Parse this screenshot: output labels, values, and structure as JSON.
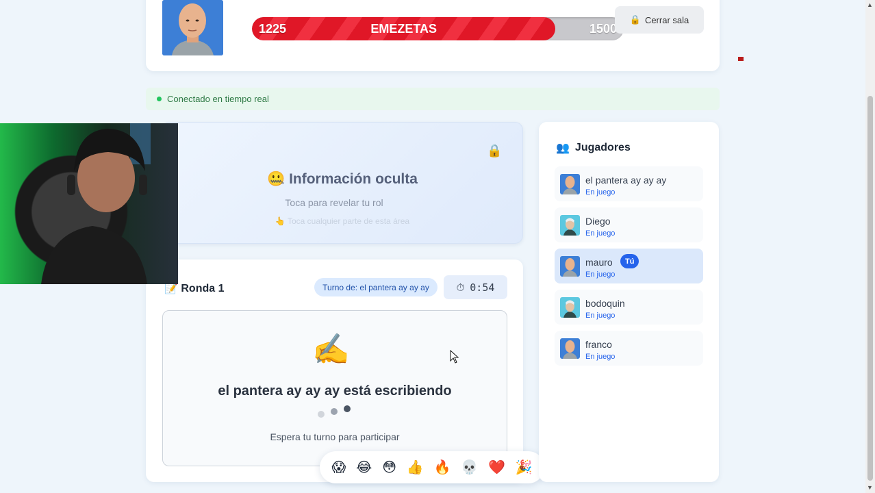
{
  "header": {
    "score_current": "1225",
    "score_title": "EMEZETAS",
    "score_max": "1500",
    "score_progress": 0.8167,
    "close_room_label": "Cerrar sala",
    "close_room_icon": "lock-icon"
  },
  "connection": {
    "status_text": "Conectado en tiempo real",
    "status_color": "#22c55e"
  },
  "hidden_info": {
    "title_emoji": "🤐",
    "title": "Información oculta",
    "subtitle": "Toca para revelar tu rol",
    "hint_emoji": "👆",
    "hint": "Toca cualquier parte de esta área",
    "lock_emoji": "🔒"
  },
  "round": {
    "icon": "📝",
    "title": "Ronda 1",
    "turn_label": "Turno de: el pantera ay ay ay",
    "timer_icon": "⏱",
    "timer": "0:54",
    "writing_emoji": "✍️",
    "writing_text": "el pantera ay ay ay está escribiendo",
    "wait_text": "Espera tu turno para participar"
  },
  "reactions": [
    "😱",
    "😂",
    "😳",
    "👍",
    "🔥",
    "💀",
    "❤️",
    "🎉"
  ],
  "players": {
    "icon": "👥",
    "title": "Jugadores",
    "list": [
      {
        "name": "el pantera ay ay ay",
        "status": "En juego",
        "avatar": "avatar-bald"
      },
      {
        "name": "Diego",
        "status": "En juego",
        "avatar": "avatar-teal"
      },
      {
        "name": "mauro",
        "status": "En juego",
        "avatar": "avatar-bald",
        "you": "Tú"
      },
      {
        "name": "bodoquin",
        "status": "En juego",
        "avatar": "avatar-teal"
      },
      {
        "name": "franco",
        "status": "En juego",
        "avatar": "avatar-bald"
      }
    ]
  },
  "colors": {
    "accent": "#2563eb",
    "score_bar": "#e01727",
    "connected": "#22c55e"
  }
}
